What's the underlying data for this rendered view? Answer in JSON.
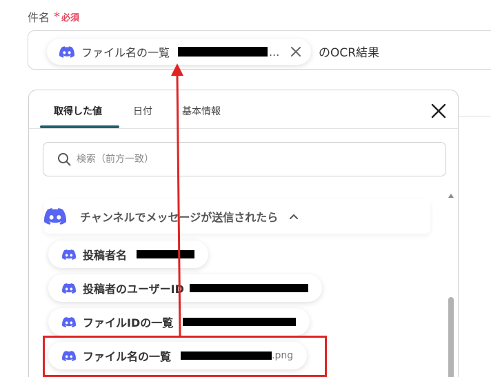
{
  "field": {
    "label": "件名",
    "required_star": "*",
    "required_text": "必須",
    "chip": {
      "icon": "discord-icon",
      "label": "ファイル名の一覧",
      "ellipsis": "..."
    },
    "suffix": "のOCR結果"
  },
  "panel": {
    "tabs": [
      {
        "label": "取得した値",
        "active": true
      },
      {
        "label": "日付",
        "active": false
      },
      {
        "label": "基本情報",
        "active": false
      }
    ],
    "search_placeholder": "検索（前方一致）",
    "section": {
      "icon": "discord-icon",
      "title": "チャンネルでメッセージが送信されたら"
    },
    "items": [
      {
        "label": "投稿者名",
        "suffix": ""
      },
      {
        "label": "投稿者のユーザーID",
        "suffix": ""
      },
      {
        "label": "ファイルIDの一覧",
        "suffix": ""
      },
      {
        "label": "ファイル名の一覧",
        "suffix": ".png"
      }
    ]
  },
  "colors": {
    "discord": "#5865F2",
    "required": "#e0465e",
    "tab_active_underline": "#21606e",
    "annotation": "#e02424"
  }
}
